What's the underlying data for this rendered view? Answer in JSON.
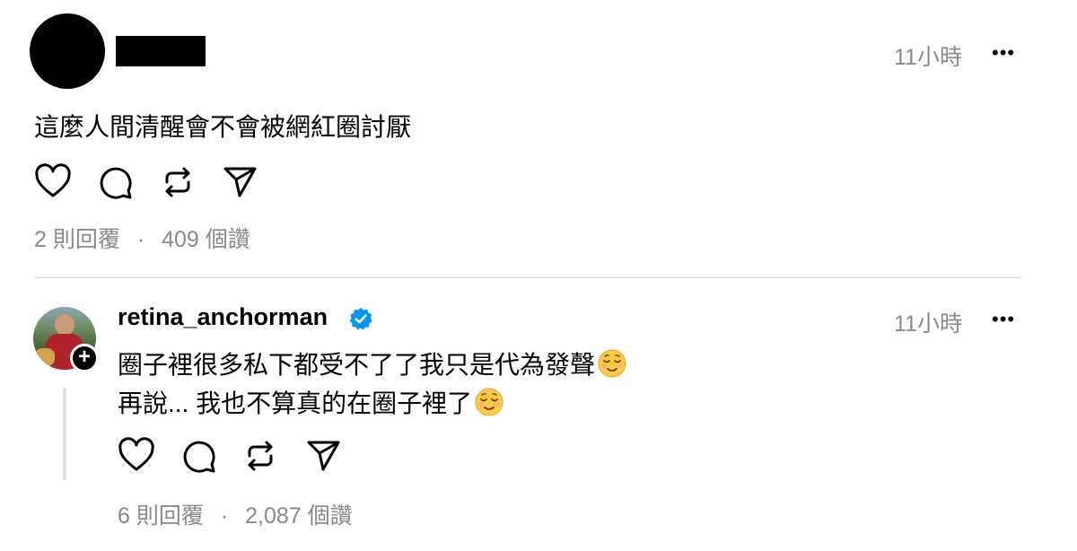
{
  "post": {
    "time": "11小時",
    "more": "•••",
    "text": "這麼人間清醒會不會被網紅圈討厭",
    "replies": "2 則回覆",
    "separator": "·",
    "likes": "409 個讚"
  },
  "reply": {
    "username": "retina_anchorman",
    "time": "11小時",
    "more": "•••",
    "line1": "圈子裡很多私下都受不了了我只是代為發聲",
    "line2": "再說... 我也不算真的在圈子裡了",
    "emoji": "relieved-face",
    "replies": "6 則回覆",
    "separator": "·",
    "likes": "2,087 個讚"
  },
  "icons": [
    "heart-icon",
    "comment-icon",
    "repost-icon",
    "share-icon",
    "more-icon",
    "verified-icon",
    "plus-icon"
  ],
  "colors": {
    "text": "#000000",
    "muted": "#8a8a8a",
    "verified": "#0095f6",
    "divider": "#dcdcdc"
  }
}
